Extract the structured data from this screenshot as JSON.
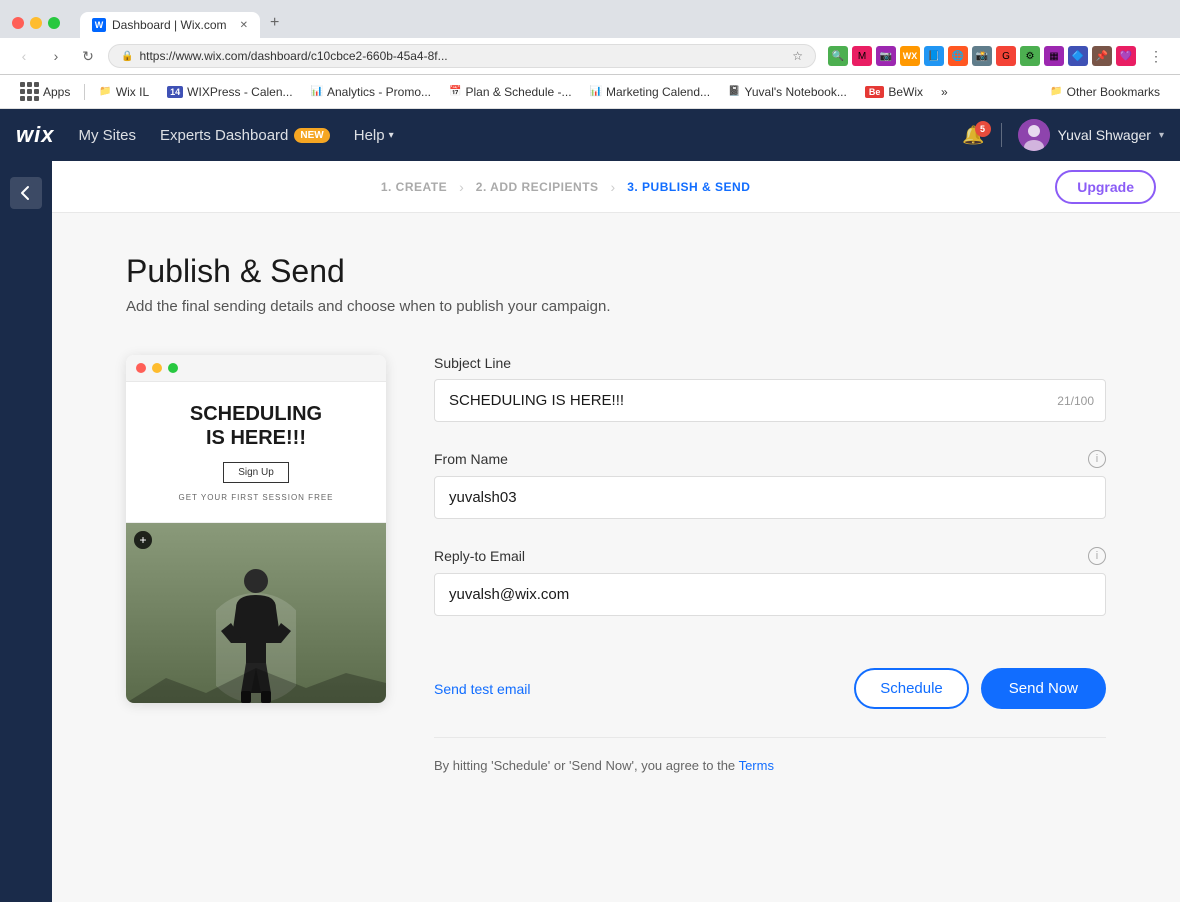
{
  "browser": {
    "tab_title": "Dashboard | Wix.com",
    "url": "https://www.wix.com/dashboard/c10cbce2-660b-45a4-8f...",
    "new_tab_label": "+"
  },
  "bookmarks": {
    "apps_label": "Apps",
    "wix_il_label": "Wix IL",
    "wixpress_label": "WIXPress - Calen...",
    "analytics_label": "Analytics - Promo...",
    "plan_label": "Plan & Schedule -...",
    "marketing_label": "Marketing Calend...",
    "yuval_label": "Yuval's Notebook...",
    "bewix_label": "BeWix",
    "other_label": "Other Bookmarks"
  },
  "navbar": {
    "logo": "wix",
    "my_sites": "My Sites",
    "experts_dashboard": "Experts Dashboard",
    "new_badge": "NEW",
    "help": "Help",
    "notification_count": "5",
    "user_name": "Yuval Shwager"
  },
  "wizard": {
    "step1_label": "1. CREATE",
    "step2_label": "2. ADD RECIPIENTS",
    "step3_label": "3. PUBLISH & SEND",
    "upgrade_label": "Upgrade"
  },
  "page": {
    "title": "Publish & Send",
    "subtitle": "Add the final sending details and choose when to publish your campaign."
  },
  "preview": {
    "heading_line1": "SCHEDULING",
    "heading_line2": "IS HERE!!!",
    "signup_btn": "Sign Up",
    "subtext": "GET YOUR FIRST SESSION FREE"
  },
  "form": {
    "subject_line_label": "Subject Line",
    "subject_line_value": "SCHEDULING IS HERE!!!",
    "subject_line_char_count": "21/100",
    "from_name_label": "From Name",
    "from_name_value": "yuvalsh03",
    "reply_to_label": "Reply-to Email",
    "reply_to_value": "yuvalsh@wix.com",
    "send_test_label": "Send test email",
    "schedule_label": "Schedule",
    "send_now_label": "Send Now",
    "terms_prefix": "By hitting 'Schedule' or 'Send Now', you agree to the",
    "terms_link": "Terms"
  }
}
